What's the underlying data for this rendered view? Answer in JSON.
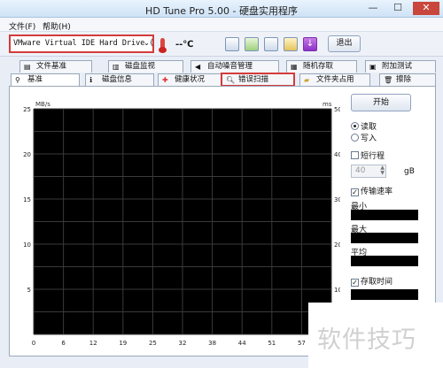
{
  "window": {
    "title": "HD Tune Pro 5.00 - 硬盘实用程序",
    "minimize": "—",
    "maximize": "☐",
    "close": "✕"
  },
  "menu": {
    "file": "文件(F)",
    "help": "帮助(H)"
  },
  "toolbar": {
    "drive": "VMware Virtual IDE Hard Drive (64",
    "temperature": "--℃",
    "exit_label": "退出"
  },
  "tabs_top": [
    {
      "label": "文件基准",
      "icon": "file-benchmark-icon"
    },
    {
      "label": "磁盘监视",
      "icon": "disk-monitor-icon"
    },
    {
      "label": "自动噪音管理",
      "icon": "speaker-icon"
    },
    {
      "label": "随机存取",
      "icon": "random-access-icon"
    },
    {
      "label": "附加测试",
      "icon": "extra-tests-icon"
    }
  ],
  "tabs_bottom": [
    {
      "label": "基准",
      "icon": "benchmark-icon"
    },
    {
      "label": "磁盘信息",
      "icon": "info-icon"
    },
    {
      "label": "健康状况",
      "icon": "health-icon"
    },
    {
      "label": "错误扫描",
      "icon": "magnifier-icon"
    },
    {
      "label": "文件夹占用",
      "icon": "folder-icon"
    },
    {
      "label": "擦除",
      "icon": "trash-icon"
    }
  ],
  "chart_data": {
    "type": "line",
    "y_unit": "MB/s",
    "y2_unit": "ms",
    "y_ticks": [
      "25",
      "20",
      "15",
      "10",
      "5"
    ],
    "y2_ticks": [
      "50",
      "40",
      "30",
      "20",
      "10"
    ],
    "x_ticks": [
      "0",
      "6",
      "12",
      "19",
      "25",
      "32",
      "38",
      "44",
      "51",
      "57"
    ],
    "ylim": [
      0,
      25
    ],
    "y2lim": [
      0,
      50
    ],
    "grid": true,
    "series": []
  },
  "panel": {
    "start_label": "开始",
    "read_label": "读取",
    "write_label": "写入",
    "short_stroke_label": "短行程",
    "short_stroke_value": "40",
    "short_stroke_unit": "gB",
    "transfer_rate_label": "传输速率",
    "min_label": "最小",
    "max_label": "最大",
    "avg_label": "平均",
    "access_time_label": "存取时间"
  },
  "watermark": "软件技巧"
}
